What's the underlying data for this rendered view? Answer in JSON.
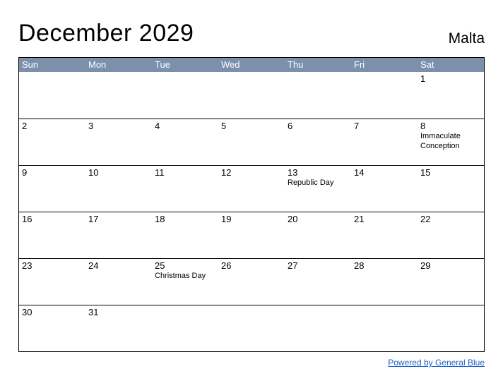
{
  "title": "December 2029",
  "region": "Malta",
  "day_headers": [
    "Sun",
    "Mon",
    "Tue",
    "Wed",
    "Thu",
    "Fri",
    "Sat"
  ],
  "weeks": [
    [
      {
        "day": "",
        "event": ""
      },
      {
        "day": "",
        "event": ""
      },
      {
        "day": "",
        "event": ""
      },
      {
        "day": "",
        "event": ""
      },
      {
        "day": "",
        "event": ""
      },
      {
        "day": "",
        "event": ""
      },
      {
        "day": "1",
        "event": ""
      }
    ],
    [
      {
        "day": "2",
        "event": ""
      },
      {
        "day": "3",
        "event": ""
      },
      {
        "day": "4",
        "event": ""
      },
      {
        "day": "5",
        "event": ""
      },
      {
        "day": "6",
        "event": ""
      },
      {
        "day": "7",
        "event": ""
      },
      {
        "day": "8",
        "event": "Immaculate Conception"
      }
    ],
    [
      {
        "day": "9",
        "event": ""
      },
      {
        "day": "10",
        "event": ""
      },
      {
        "day": "11",
        "event": ""
      },
      {
        "day": "12",
        "event": ""
      },
      {
        "day": "13",
        "event": "Republic Day"
      },
      {
        "day": "14",
        "event": ""
      },
      {
        "day": "15",
        "event": ""
      }
    ],
    [
      {
        "day": "16",
        "event": ""
      },
      {
        "day": "17",
        "event": ""
      },
      {
        "day": "18",
        "event": ""
      },
      {
        "day": "19",
        "event": ""
      },
      {
        "day": "20",
        "event": ""
      },
      {
        "day": "21",
        "event": ""
      },
      {
        "day": "22",
        "event": ""
      }
    ],
    [
      {
        "day": "23",
        "event": ""
      },
      {
        "day": "24",
        "event": ""
      },
      {
        "day": "25",
        "event": "Christmas Day"
      },
      {
        "day": "26",
        "event": ""
      },
      {
        "day": "27",
        "event": ""
      },
      {
        "day": "28",
        "event": ""
      },
      {
        "day": "29",
        "event": ""
      }
    ],
    [
      {
        "day": "30",
        "event": ""
      },
      {
        "day": "31",
        "event": ""
      },
      {
        "day": "",
        "event": ""
      },
      {
        "day": "",
        "event": ""
      },
      {
        "day": "",
        "event": ""
      },
      {
        "day": "",
        "event": ""
      },
      {
        "day": "",
        "event": ""
      }
    ]
  ],
  "footer_link": "Powered by General Blue"
}
